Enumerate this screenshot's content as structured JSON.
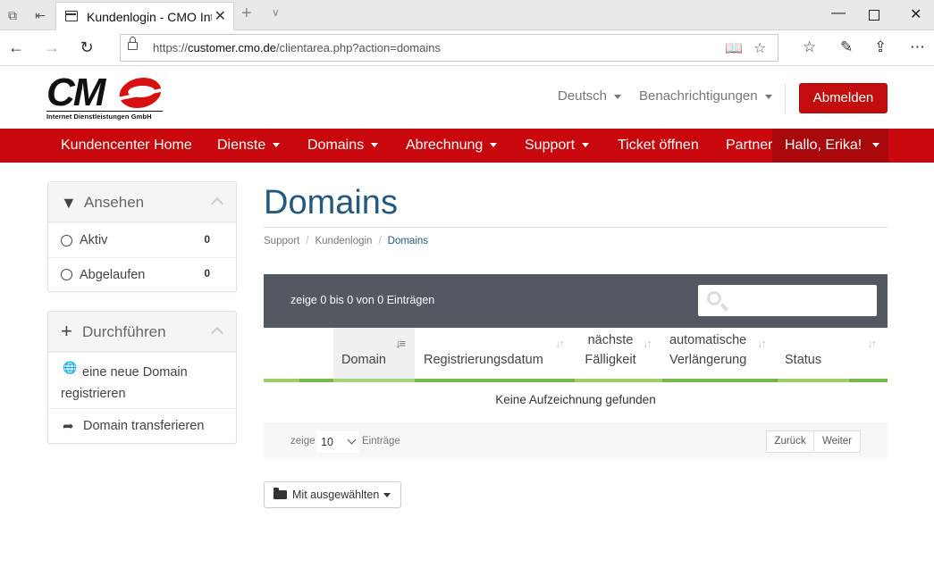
{
  "browser": {
    "tab_title": "Kundenlogin - CMO Internet Dienstleistungen",
    "url_prefix": "https://",
    "url_host": "customer.cmo.de",
    "url_path": "/clientarea.php?action=domains"
  },
  "header": {
    "logo_text": "CM",
    "logo_subtitle": "Internet Dienstleistungen GmbH",
    "language": "Deutsch",
    "notifications": "Benachrichtigungen",
    "logout": "Abmelden"
  },
  "nav": {
    "home": "Kundencenter Home",
    "services": "Dienste",
    "domains": "Domains",
    "billing": "Abrechnung",
    "support": "Support",
    "open_ticket": "Ticket öffnen",
    "partner": "Partner",
    "user": "Hallo, Erika!"
  },
  "sidebar": {
    "view": {
      "title": "Ansehen",
      "items": [
        {
          "label": "Aktiv",
          "count": "0"
        },
        {
          "label": "Abgelaufen",
          "count": "0"
        }
      ]
    },
    "actions": {
      "title": "Durchführen",
      "items": [
        {
          "label": "eine neue Domain registrieren"
        },
        {
          "label": "Domain transferieren"
        }
      ]
    }
  },
  "main": {
    "title": "Domains",
    "breadcrumb": [
      "Support",
      "Kundenlogin",
      "Domains"
    ],
    "table": {
      "info": "zeige 0 bis 0 von 0 Einträgen",
      "search_placeholder": "",
      "columns": [
        {
          "label": "Domain"
        },
        {
          "label": "Registrierungsdatum"
        },
        {
          "label": "nächste Fälligkeit"
        },
        {
          "label": "automatische Verlängerung"
        },
        {
          "label": "Status"
        }
      ],
      "empty_message": "Keine Aufzeichnung gefunden",
      "show_label": "zeige",
      "page_length": "10",
      "entries_label": "Einträge",
      "prev": "Zurück",
      "next": "Weiter"
    },
    "bulk_action": "Mit ausgewählten"
  },
  "colors": {
    "brand_red": "#c8080c",
    "title_blue": "#215a80",
    "table_head": "#545860",
    "accent_green": "#8cc63f"
  }
}
